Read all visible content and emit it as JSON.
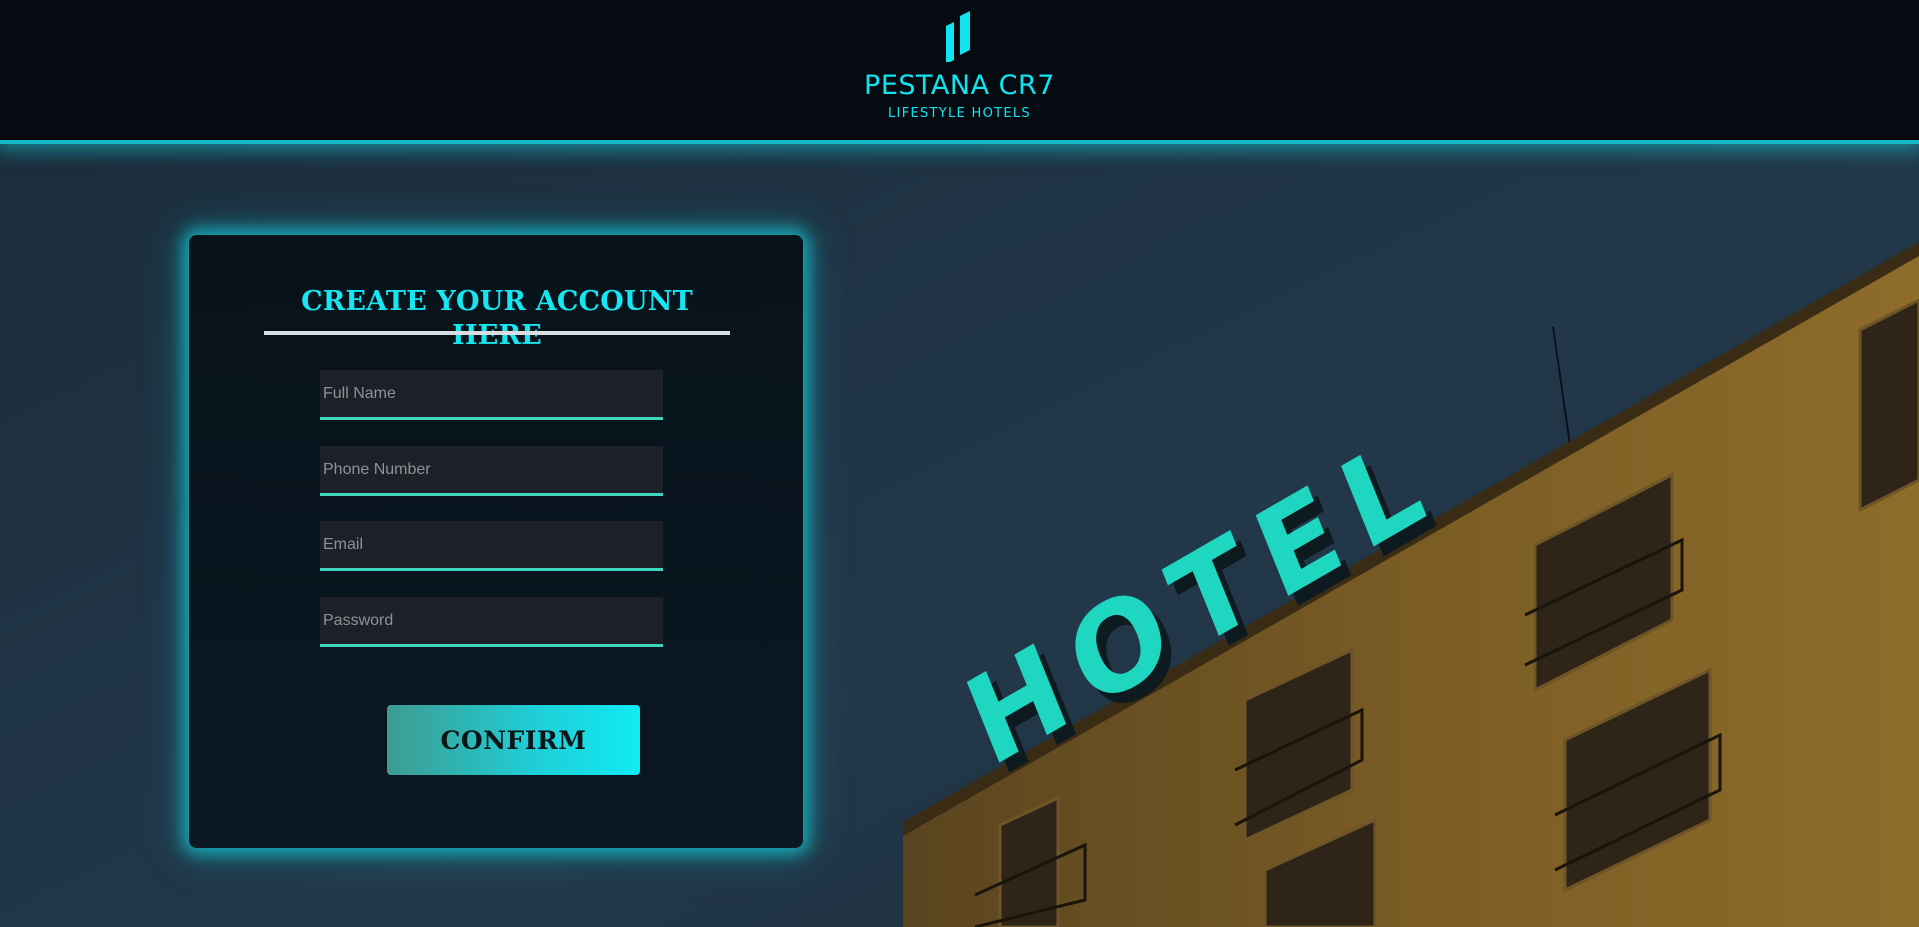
{
  "brand": {
    "name": "PESTANA CR7",
    "tagline": "LIFESTYLE HOTELS",
    "logo_icon": "pestana-mark-icon",
    "accent_color": "#10e4f0"
  },
  "background": {
    "sign_text": "HOTEL",
    "sign_color": "#1fd6c0",
    "building_color": "#8a6a28"
  },
  "form": {
    "title": "CREATE YOUR ACCOUNT HERE",
    "fields": [
      {
        "name": "full-name",
        "placeholder": "Full Name",
        "value": ""
      },
      {
        "name": "phone-number",
        "placeholder": "Phone Number",
        "value": ""
      },
      {
        "name": "email",
        "placeholder": "Email",
        "value": ""
      },
      {
        "name": "password",
        "placeholder": "Password",
        "value": ""
      }
    ],
    "submit_label": "CONFIRM"
  }
}
